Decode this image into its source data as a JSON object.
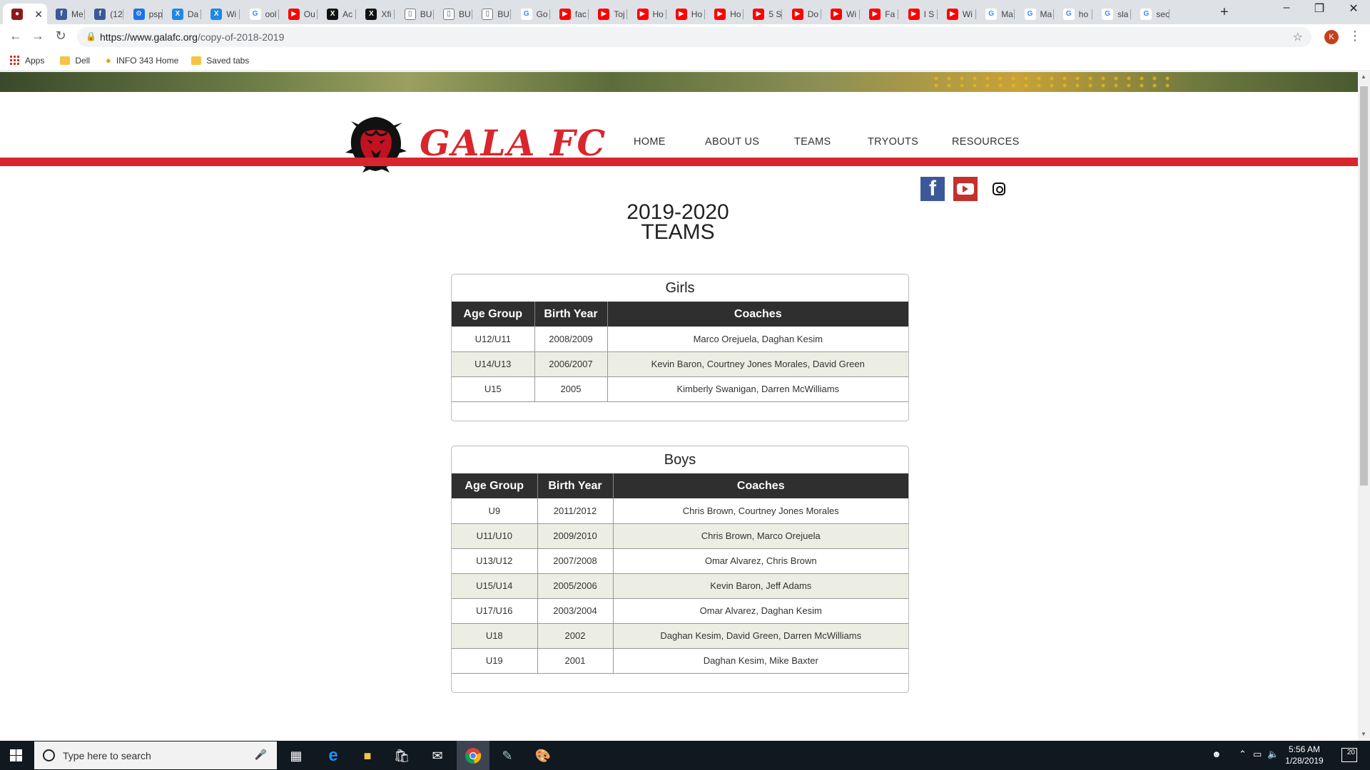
{
  "browser": {
    "tabs": [
      {
        "label": "",
        "icon": "gala-icon",
        "active": true
      },
      {
        "label": "Me",
        "icon": "facebook-icon"
      },
      {
        "label": "(12",
        "icon": "facebook-icon"
      },
      {
        "label": "psp",
        "icon": "globe-icon"
      },
      {
        "label": "Da",
        "icon": "x-icon"
      },
      {
        "label": "Wi",
        "icon": "x-icon"
      },
      {
        "label": "ool",
        "icon": "google-icon"
      },
      {
        "label": "Ou",
        "icon": "youtube-icon"
      },
      {
        "label": "Ac",
        "icon": "x-black-icon"
      },
      {
        "label": "Xfi",
        "icon": "x-black-icon"
      },
      {
        "label": "BU",
        "icon": "doc-icon"
      },
      {
        "label": "BU",
        "icon": "doc-icon"
      },
      {
        "label": "BU",
        "icon": "doc-icon"
      },
      {
        "label": "Go",
        "icon": "google-icon"
      },
      {
        "label": "fac",
        "icon": "youtube-icon"
      },
      {
        "label": "Toj",
        "icon": "youtube-icon"
      },
      {
        "label": "Ho",
        "icon": "youtube-icon"
      },
      {
        "label": "Ho",
        "icon": "youtube-icon"
      },
      {
        "label": "Ho",
        "icon": "youtube-icon"
      },
      {
        "label": "5 S",
        "icon": "youtube-icon"
      },
      {
        "label": "Do",
        "icon": "youtube-icon"
      },
      {
        "label": "Wi",
        "icon": "youtube-icon"
      },
      {
        "label": "Fa",
        "icon": "youtube-icon"
      },
      {
        "label": "I S",
        "icon": "youtube-icon"
      },
      {
        "label": "Wi",
        "icon": "youtube-icon"
      },
      {
        "label": "Ma",
        "icon": "google-icon"
      },
      {
        "label": "Ma",
        "icon": "google-icon"
      },
      {
        "label": "ho",
        "icon": "google-icon"
      },
      {
        "label": "sla",
        "icon": "google-icon"
      },
      {
        "label": "sec",
        "icon": "google-icon"
      }
    ],
    "url_host": "https://www.galafc.org",
    "url_path": "/copy-of-2018-2019",
    "profile_initial": "K",
    "bookmarks": {
      "apps": "Apps",
      "dell": "Dell",
      "info": "INFO 343 Home",
      "saved": "Saved tabs"
    }
  },
  "site": {
    "logo_text": "GALA FC",
    "nav": [
      "HOME",
      "ABOUT US",
      "TEAMS",
      "TRYOUTS",
      "RESOURCES"
    ],
    "title_line1": "2019-2020",
    "title_line2": "TEAMS",
    "colors": {
      "accent": "#d9262c",
      "header_row": "#2f2f2f",
      "alt_row": "#edeee3"
    }
  },
  "girls": {
    "caption": "Girls",
    "headers": [
      "Age Group",
      "Birth Year",
      "Coaches"
    ],
    "rows": [
      [
        "U12/U11",
        "2008/2009",
        "Marco Orejuela, Daghan Kesim"
      ],
      [
        "U14/U13",
        "2006/2007",
        "Kevin Baron, Courtney Jones Morales, David Green"
      ],
      [
        "U15",
        "2005",
        "Kimberly Swanigan, Darren McWilliams"
      ]
    ]
  },
  "boys": {
    "caption": "Boys",
    "headers": [
      "Age Group",
      "Birth Year",
      "Coaches"
    ],
    "rows": [
      [
        "U9",
        "2011/2012",
        "Chris Brown, Courtney Jones Morales"
      ],
      [
        "U11/U10",
        "2009/2010",
        "Chris Brown, Marco Orejuela"
      ],
      [
        "U13/U12",
        "2007/2008",
        "Omar Alvarez, Chris Brown"
      ],
      [
        "U15/U14",
        "2005/2006",
        "Kevin Baron, Jeff Adams"
      ],
      [
        "U17/U16",
        "2003/2004",
        "Omar Alvarez, Daghan Kesim"
      ],
      [
        "U18",
        "2002",
        "Daghan Kesim, David Green, Darren McWilliams"
      ],
      [
        "U19",
        "2001",
        "Daghan Kesim, Mike Baxter"
      ]
    ]
  },
  "taskbar": {
    "search_placeholder": "Type here to search",
    "time": "5:56 AM",
    "date": "1/28/2019",
    "notifications": "20"
  }
}
